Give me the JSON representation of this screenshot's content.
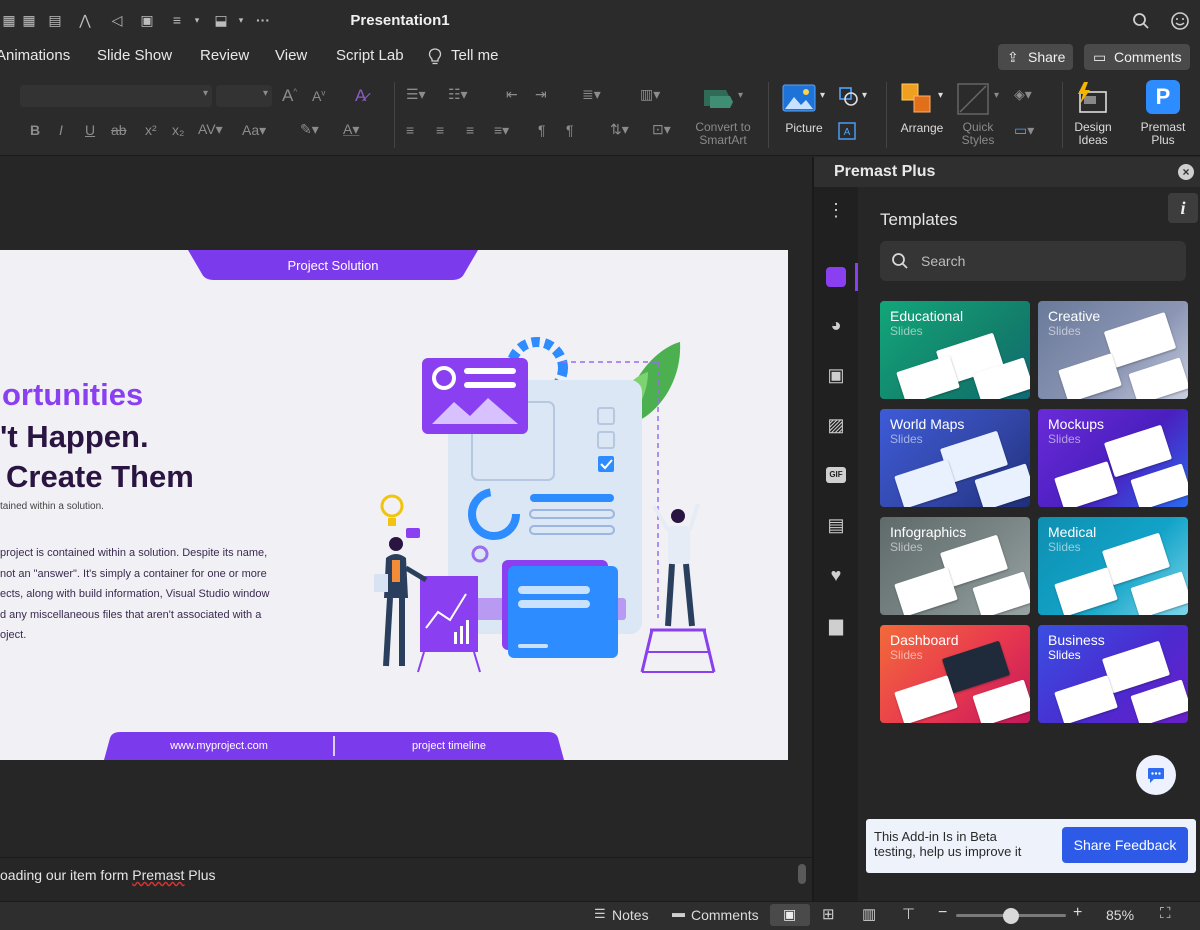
{
  "app": {
    "document_title": "Presentation1"
  },
  "menu": {
    "items": [
      "Animations",
      "Slide Show",
      "Review",
      "View",
      "Script Lab",
      "Tell me"
    ],
    "share_label": "Share",
    "comments_label": "Comments"
  },
  "ribbon": {
    "picture": "Picture",
    "convert_smartart": [
      "Convert to",
      "SmartArt"
    ],
    "arrange": "Arrange",
    "quick_styles": [
      "Quick",
      "Styles"
    ],
    "design_ideas": [
      "Design",
      "Ideas"
    ],
    "premast_plus": [
      "Premast",
      "Plus"
    ]
  },
  "slide": {
    "top_tab": "Project Solution",
    "headline1": "ortunities",
    "headline2": "'t Happen.",
    "headline3": "Create Them",
    "subtitle": "tained within a solution.",
    "body_lines": [
      "project is contained within a solution. Despite its name,",
      "not an \"answer\". It's simply a container for one or more",
      "ects, along with build information, Visual Studio window",
      "d any miscellaneous files that aren't associated with a",
      "oject."
    ],
    "footer_left": "www.myproject.com",
    "footer_right": "project timeline",
    "colors": {
      "accent": "#7c3aed",
      "headline_dark": "#3b1d5e",
      "blue": "#2d8cff"
    }
  },
  "notes": {
    "text_before": "oading our item form ",
    "text_link": "Premast",
    "text_after": " Plus"
  },
  "status": {
    "notes": "Notes",
    "comments": "Comments",
    "zoom": "85%",
    "zoom_fraction": 0.5
  },
  "pane": {
    "title": "Premast Plus",
    "heading": "Templates",
    "search_placeholder": "Search",
    "info_icon": "i",
    "templates": [
      {
        "title": "Educational",
        "sub": "Slides"
      },
      {
        "title": "Creative",
        "sub": "Slides"
      },
      {
        "title": "World Maps",
        "sub": "Slides"
      },
      {
        "title": "Mockups",
        "sub": "Slides"
      },
      {
        "title": "Infographics",
        "sub": "Slides"
      },
      {
        "title": "Medical",
        "sub": "Slides"
      },
      {
        "title": "Dashboard",
        "sub": "Slides"
      },
      {
        "title": "Business",
        "sub": "Slides"
      }
    ],
    "beta_text": [
      "This Add-in Is in Beta",
      "testing, help us improve it"
    ],
    "feedback_button": "Share Feedback"
  }
}
